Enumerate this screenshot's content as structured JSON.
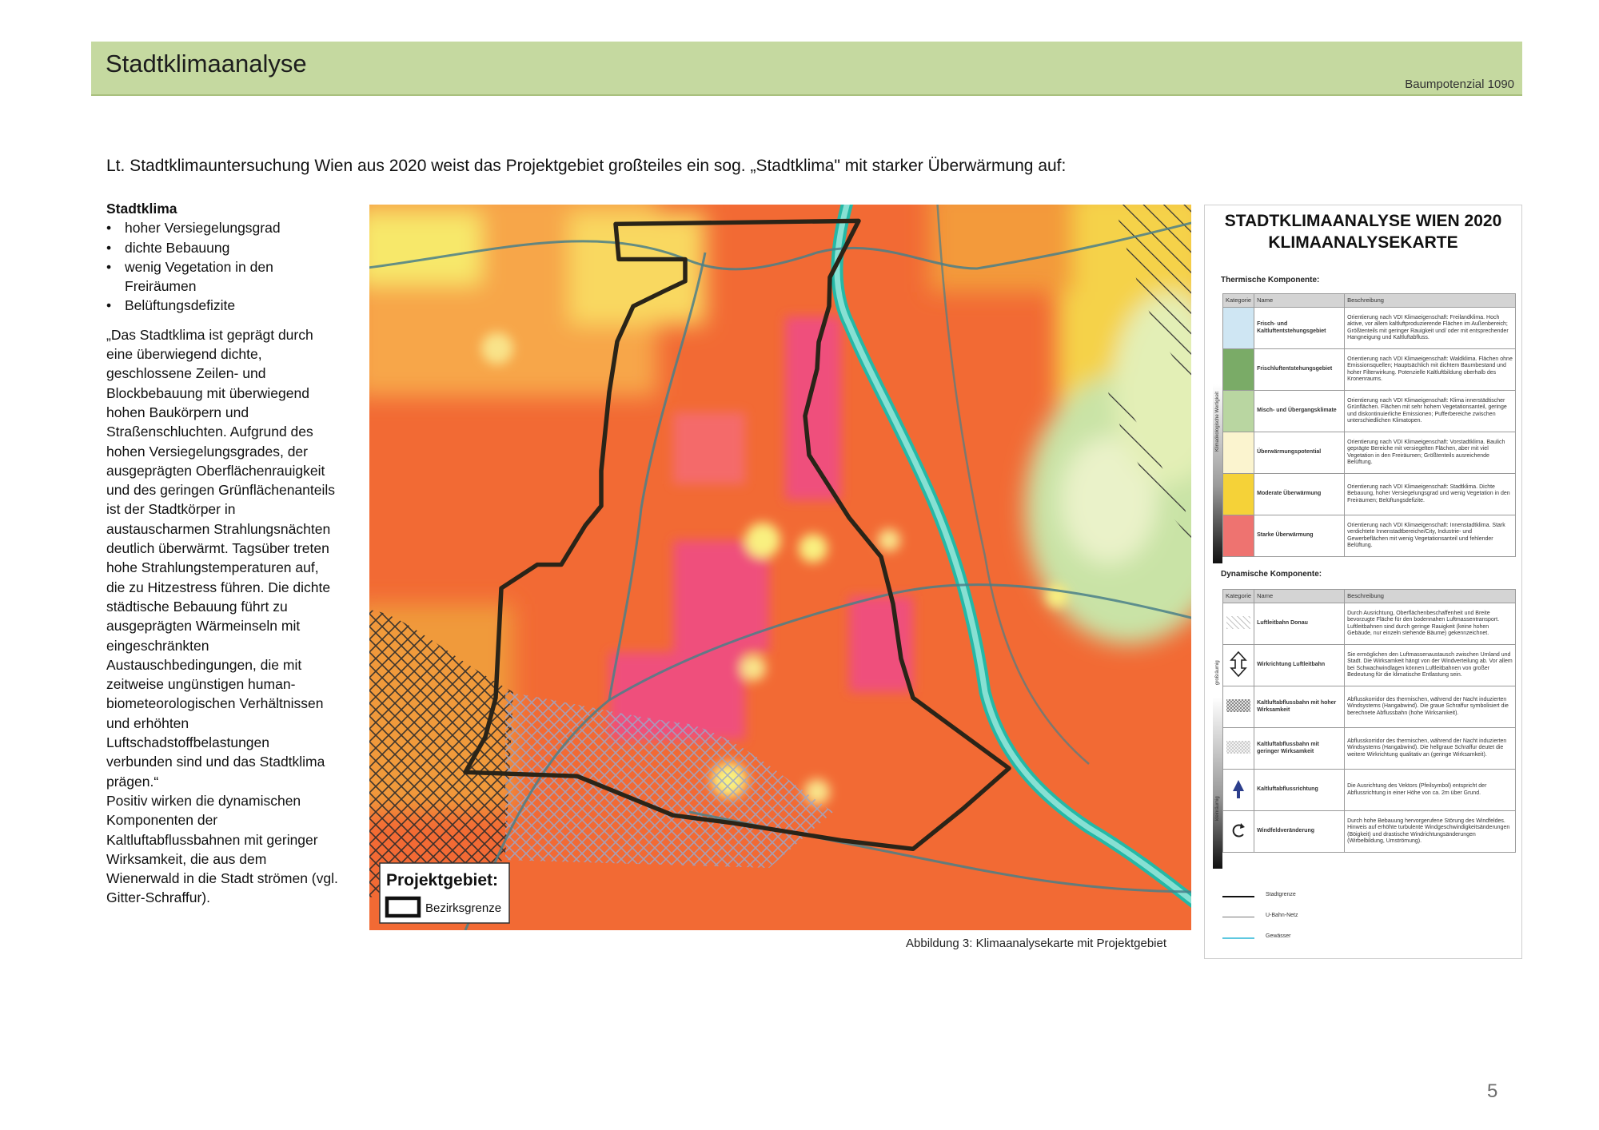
{
  "header": {
    "title": "Stadtklimaanalyse",
    "subtitle": "Baumpotenzial 1090"
  },
  "intro": "Lt. Stadtklimauntersuchung Wien aus 2020 weist das Projektgebiet großteiles ein sog. „Stadtklima\" mit starker Überwärmung auf:",
  "sidebar": {
    "heading": "Stadtklima",
    "bullets": [
      "hoher Versiegelungsgrad",
      "dichte Bebauung",
      "wenig Vegetation in den Freiräumen",
      "Belüftungsdefizite"
    ],
    "quote": "„Das Stadtklima ist geprägt durch eine überwiegend dichte, geschlossene Zeilen- und Blockbebauung mit überwiegend hohen Baukörpern und Straßenschluchten. Aufgrund des hohen Versiegelungsgrades, der ausgeprägten Oberflächenrauigkeit und des geringen Grünflächenanteils ist der Stadtkörper in austauscharmen Strahlungsnächten deutlich überwärmt. Tagsüber treten hohe Strahlungstemperaturen auf, die zu Hitzestress führen. Die dichte städtische Bebauung führt zu ausgeprägten Wärmeinseln mit eingeschränkten Austauschbedingungen, die mit zeitweise ungünstigen human-biometeorologischen Verhältnissen und erhöhten Luftschadstoffbelastungen verbunden sind und das Stadtklima prägen.“",
    "positive": "Positiv wirken die dynamischen Komponenten der Kaltluftabflussbahnen mit geringer Wirksamkeit, die aus dem Wienerwald in die Stadt strömen (vgl. Gitter-Schraffur)."
  },
  "map": {
    "inset_title": "Projektgebiet:",
    "inset_label": "Bezirksgrenze",
    "caption": "Abbildung 3: Klimaanalysekarte mit Projektgebiet"
  },
  "legend": {
    "title_line1": "STADTKLIMAANALYSE WIEN 2020",
    "title_line2": "KLIMAANALYSEKARTE",
    "thermal_heading": "Thermische Komponente:",
    "dynamic_heading": "Dynamische Komponente:",
    "col_headers": [
      "Kategorie",
      "Name",
      "Beschreibung"
    ],
    "thermal_side_label": "Klimaökologische Wertigkeit",
    "thermal_rows": [
      {
        "name": "Frisch- und Kaltluftentstehungsgebiet",
        "color": "#cfe6f3",
        "desc": "Orientierung nach VDI Klimaeigenschaft: Freilandklima. Hoch aktive, vor allem kaltluftproduzierende Flächen im Außenbereich; Größtenteils mit geringer Rauigkeit und/ oder mit entsprechender Hangneigung und Kaltluftabfluss."
      },
      {
        "name": "Frischluftentstehungsgebiet",
        "color": "#7aab67",
        "desc": "Orientierung nach VDI Klimaeigenschaft: Waldklima. Flächen ohne Emissionsquellen; Hauptsächlich mit dichtem Baumbestand und hoher Filterwirkung. Potenzielle Kaltluftbildung oberhalb des Kronenraums."
      },
      {
        "name": "Misch- und Übergangsklimate",
        "color": "#b9d6a1",
        "desc": "Orientierung nach VDI Klimaeigenschaft: Klima innerstädtischer Grünflächen. Flächen mit sehr hohem Vegetationsanteil, geringe und diskontinuierliche Emissionen; Pufferbereiche zwischen unterschiedlichen Klimatopen."
      },
      {
        "name": "Überwärmungspotential",
        "color": "#fbf4cf",
        "desc": "Orientierung nach VDI Klimaeigenschaft: Vorstadtklima. Baulich geprägte Bereiche mit versiegelten Flächen, aber mit viel Vegetation in den Freiräumen; Größtenteils ausreichende Belüftung."
      },
      {
        "name": "Moderate Überwärmung",
        "color": "#f5d238",
        "desc": "Orientierung nach VDI Klimaeigenschaft: Stadtklima. Dichte Bebauung, hoher Versiegelungsgrad und wenig Vegetation in den Freiräumen; Belüftungsdefizite."
      },
      {
        "name": "Starke Überwärmung",
        "color": "#ee7370",
        "desc": "Orientierung nach VDI Klimaeigenschaft: Innenstadtklima. Stark verdichtete Innenstadtbereiche/City, Industrie- und Gewerbeflächen mit wenig Vegetationsanteil und fehlender Belüftung."
      }
    ],
    "dynamic_side_label_top": "großräumig",
    "dynamic_side_label_bottom": "kleinräumig",
    "dynamic_rows": [
      {
        "name": "Luftleitbahn Donau",
        "icon": "diagonal-hatch-icon",
        "desc": "Durch Ausrichtung, Oberflächenbeschaffenheit und Breite bevorzugte Fläche für den bodennahen Luftmassentransport. Luftleitbahnen sind durch geringe Rauigkeit (keine hohen Gebäude, nur einzeln stehende Bäume) gekennzeichnet."
      },
      {
        "name": "Wirkrichtung Luftleitbahn",
        "icon": "double-arrow-icon",
        "desc": "Sie ermöglichen den Luftmassenaustausch zwischen Umland und Stadt. Die Wirksamkeit hängt von der Windverteilung ab. Vor allem bei Schwachwindlagen können Luftleitbahnen von großer Bedeutung für die klimatische Entlastung sein."
      },
      {
        "name": "Kaltluftabflussbahn mit hoher Wirksamkeit",
        "icon": "dense-crosshatch-icon",
        "desc": "Abflusskorridor des thermischen, während der Nacht induzierten Windsystems (Hangabwind). Die graue Schraffur symbolisiert die berechnete Abflussbahn (hohe Wirksamkeit)."
      },
      {
        "name": "Kaltluftabflussbahn mit geringer Wirksamkeit",
        "icon": "light-crosshatch-icon",
        "desc": "Abflusskorridor des thermischen, während der Nacht induzierten Windsystems (Hangabwind). Die hellgraue Schraffur deutet die weitere Wirkrichtung qualitativ an (geringe Wirksamkeit)."
      },
      {
        "name": "Kaltluftabflussrichtung",
        "icon": "blue-arrow-icon",
        "desc": "Die Ausrichtung des Vektors (Pfeilsymbol) entspricht der Abflussrichtung in einer Höhe von ca. 2m über Grund."
      },
      {
        "name": "Windfeldveränderung",
        "icon": "rotation-arrow-icon",
        "desc": "Durch hohe Bebauung hervorgerufene Störung des Windfeldes. Hinweis auf erhöhte turbulente Windgeschwindigkeitsänderungen (Böigkeit) und drastische Windrichtungsänderungen (Wirbelbildung, Umströmung)."
      }
    ],
    "lines": [
      {
        "label": "Stadtgrenze",
        "color": "#111111"
      },
      {
        "label": "U-Bahn-Netz",
        "color": "#777777"
      },
      {
        "label": "Gewässer",
        "color": "#5ec8e0"
      }
    ]
  },
  "page_number": "5"
}
